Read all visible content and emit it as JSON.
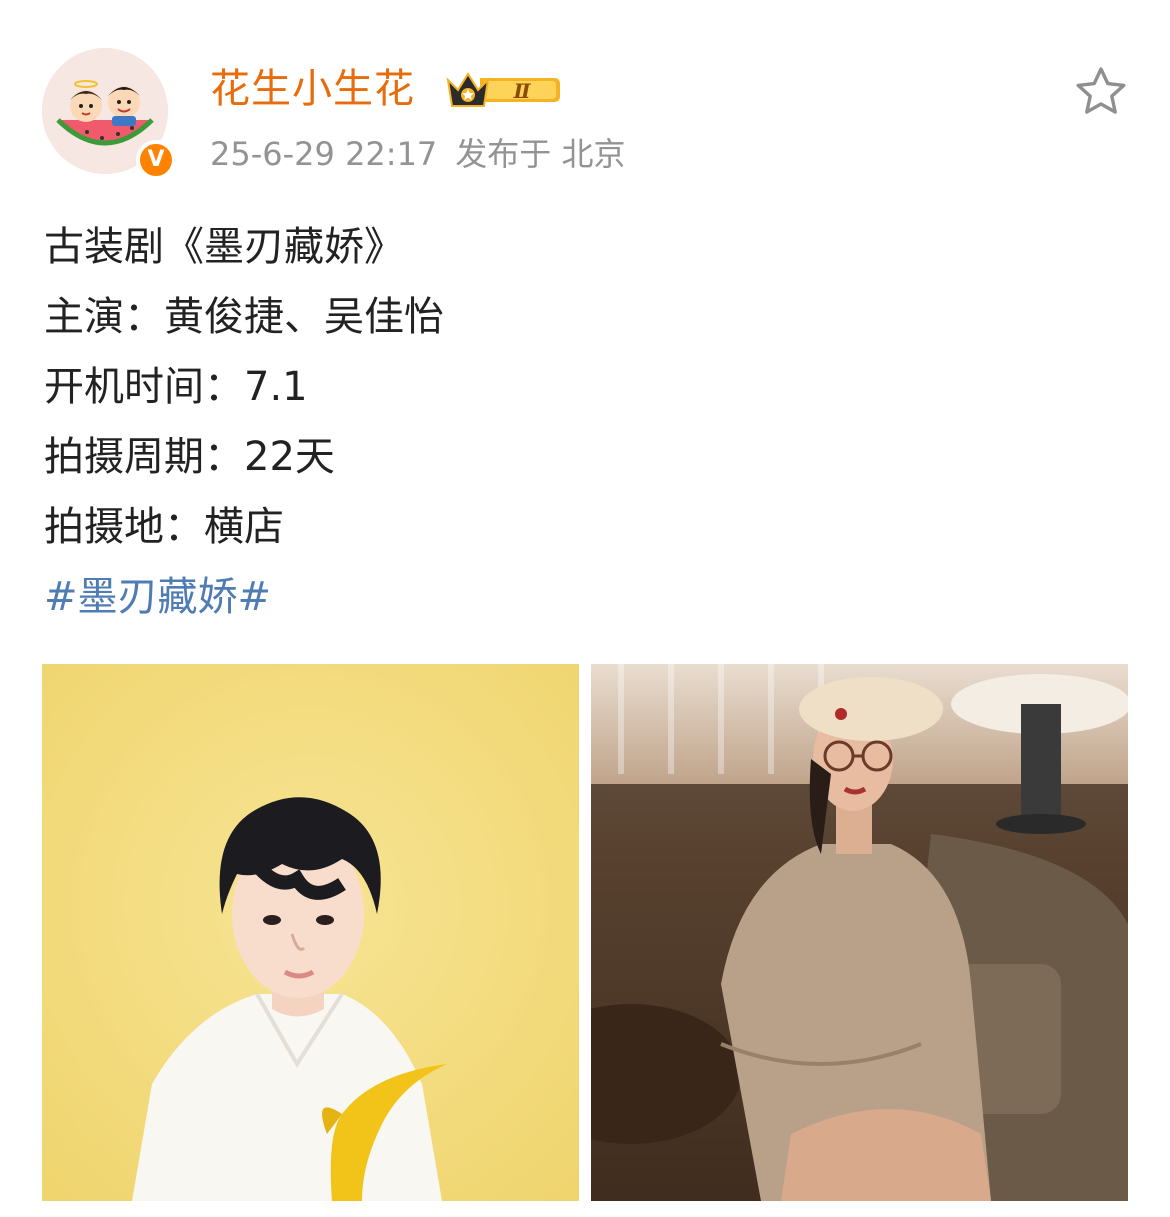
{
  "post": {
    "author": {
      "name": "花生小生花",
      "vip_level": "Ⅱ",
      "verified_mark": "V",
      "avatar_icon": "cartoon-couple-watermelon-avatar"
    },
    "meta": {
      "date": "25-6-29 22:17",
      "location": "发布于 北京"
    },
    "actions": {
      "favorite_icon": "star-outline-icon"
    },
    "content": {
      "line1": "古装剧《墨刃藏娇》",
      "line2": "主演：黄俊捷、吴佳怡",
      "line3": "开机时间：7.1",
      "line4": "拍摄周期：22天",
      "line5": "拍摄地：横店",
      "hashtag": "#墨刃藏娇#"
    },
    "photos": [
      {
        "subject": "young-man-white-shirt-yellow-calla-lily"
      },
      {
        "subject": "young-woman-beret-glasses-cafe"
      }
    ],
    "colors": {
      "name": "#e86b0c",
      "meta": "#939393",
      "hashtag": "#4f7cb5",
      "verified": "#ff8200",
      "vip_gold": "#f5b324"
    }
  }
}
